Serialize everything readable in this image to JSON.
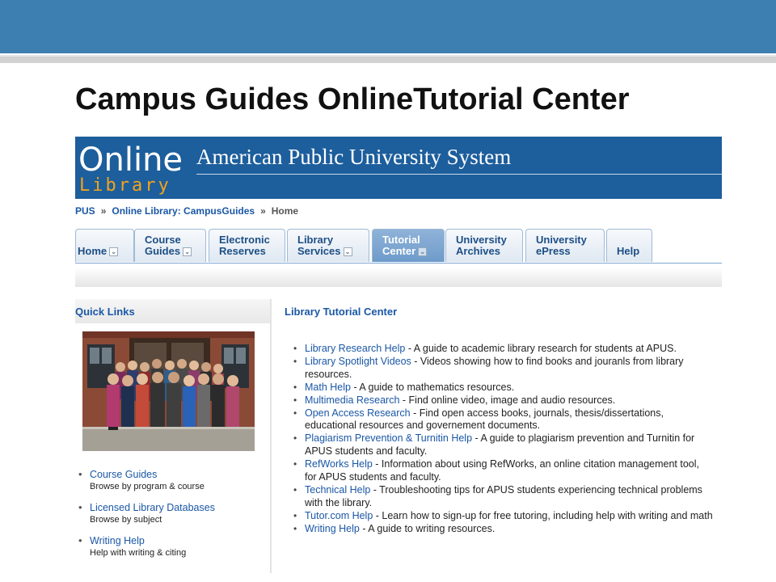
{
  "slide": {
    "title": "Campus Guides OnlineTutorial Center"
  },
  "banner": {
    "logo_top": "Online",
    "logo_bottom": "Library",
    "title": "American Public University System"
  },
  "breadcrumb": {
    "items": [
      "PUS",
      "Online Library: CampusGuides",
      "Home"
    ],
    "separator": "»"
  },
  "nav": {
    "tabs": [
      {
        "line1": "",
        "line2": "Home"
      },
      {
        "line1": "Course",
        "line2": "Guides"
      },
      {
        "line1": "Electronic",
        "line2": "Reserves"
      },
      {
        "line1": "Library",
        "line2": "Services"
      },
      {
        "line1": "Tutorial",
        "line2": "Center"
      },
      {
        "line1": "University",
        "line2": "Archives"
      },
      {
        "line1": "University",
        "line2": "ePress"
      },
      {
        "line1": "",
        "line2": "Help"
      }
    ],
    "dropdown_glyph": "⌄",
    "active_tab": "Tutorial Center"
  },
  "sidebar": {
    "heading": "Quick Links",
    "bullet": "•",
    "links": [
      {
        "title": "Course Guides",
        "desc": "Browse by program & course"
      },
      {
        "title": "Licensed Library Databases",
        "desc": "Browse by subject"
      },
      {
        "title": "Writing Help",
        "desc": "Help with writing & citing"
      }
    ]
  },
  "main": {
    "title": "Library Tutorial Center",
    "bullet": "•",
    "resources": [
      {
        "link": "Library Research Help",
        "text": " - A guide to academic library research for students at APUS."
      },
      {
        "link": "Library Spotlight Videos",
        "text": " - Videos showing how to find books and jouranls from library resources."
      },
      {
        "link": "Math Help",
        "text": " - A guide to mathematics resources."
      },
      {
        "link": "Multimedia Research",
        "text": " - Find online video, image and audio resources."
      },
      {
        "link": "Open Access Research",
        "text": " - Find open access books, journals, thesis/dissertations, educational resources and governement documents."
      },
      {
        "link": "Plagiarism Prevention & Turnitin Help",
        "text": " - A guide to plagiarism prevention and Turnitin for APUS students and faculty."
      },
      {
        "link": "RefWorks Help",
        "text": " - Information about using RefWorks, an online citation management tool, for APUS students and faculty."
      },
      {
        "link": "Technical Help",
        "text": " - Troubleshooting tips for APUS students experiencing technical problems with the library."
      },
      {
        "link": "Tutor.com Help",
        "text": " - Learn how to sign-up for free tutoring, including help with writing and math"
      },
      {
        "link": "Writing Help",
        "text": " - A guide to writing resources."
      }
    ]
  },
  "colors": {
    "banner": "#1d5e9c",
    "slide_bar": "#3d7fb0",
    "link": "#1a57a6",
    "logo_accent": "#f2a31b"
  }
}
